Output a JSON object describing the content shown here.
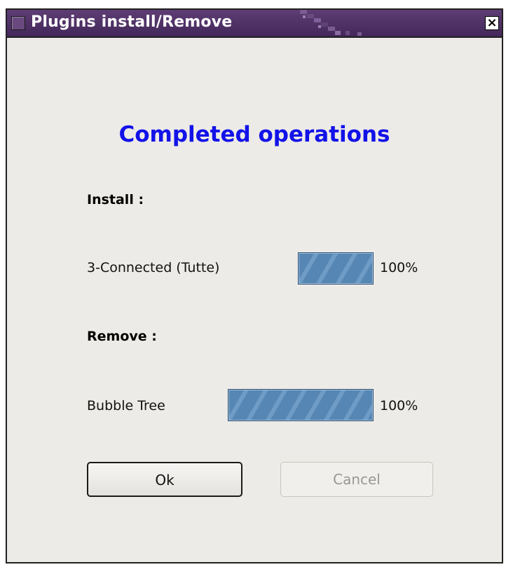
{
  "window": {
    "title": "Plugins install/Remove",
    "close_glyph": "×"
  },
  "heading": "Completed operations",
  "install": {
    "section_label": "Install :",
    "items": [
      {
        "name": "3-Connected (Tutte)",
        "progress": 1.0,
        "percent_label": "100%"
      }
    ]
  },
  "remove": {
    "section_label": "Remove :",
    "items": [
      {
        "name": "Bubble Tree",
        "progress": 1.0,
        "percent_label": "100%"
      }
    ]
  },
  "buttons": {
    "ok_label": "Ok",
    "cancel_label": "Cancel"
  },
  "colors": {
    "title_bar": "#4f3366",
    "heading": "#1212e8",
    "progress_fill": "#5a8ab6",
    "dialog_bg": "#edebe7"
  }
}
